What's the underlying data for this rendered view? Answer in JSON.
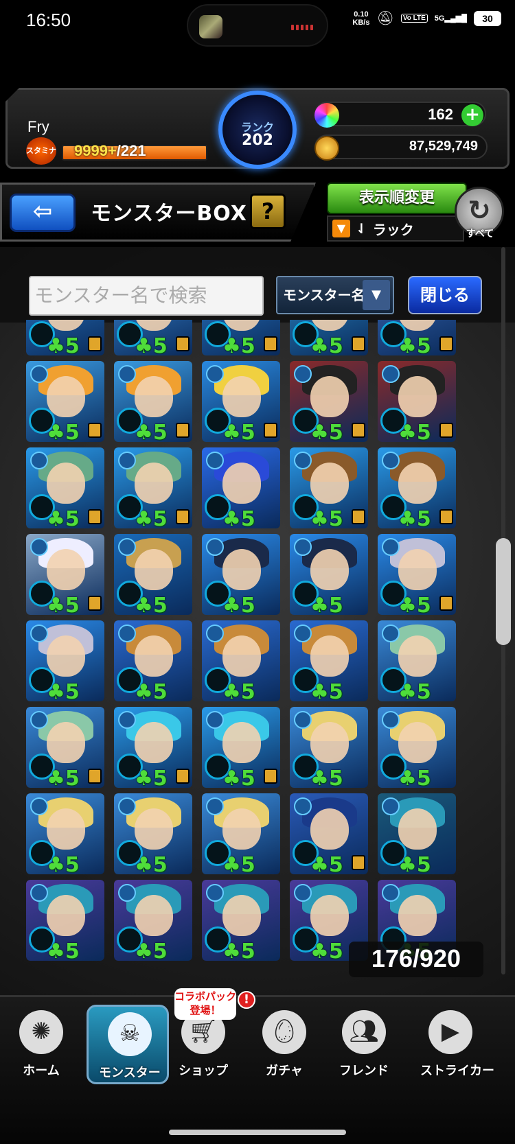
{
  "status_bar": {
    "time": "16:50",
    "net_speed_value": "0.10",
    "net_speed_unit": "KB/s",
    "volte": "Vo LTE",
    "network": "5G",
    "battery": "30"
  },
  "player": {
    "name": "Fry",
    "stamina_badge": "スタミナ",
    "stamina_current": "9999+",
    "stamina_max": "/221",
    "stamina_fill_fraction": 1.0,
    "rank_label": "ランク",
    "rank_value": "202"
  },
  "currency": {
    "orbs": "162",
    "add_orb_label": "+",
    "gold": "87,529,749"
  },
  "title_bar": {
    "back_icon": "arrow-left-icon",
    "back_glyph": "⇦",
    "title": "モンスターBOX",
    "help_label": "?"
  },
  "sort": {
    "button_label": "表示順変更",
    "criteria": "ラック",
    "filter_glyph": "▼",
    "sort_glyph": "⇃",
    "refresh_glyph": "↻",
    "refresh_label": "すべて"
  },
  "search": {
    "placeholder": "モンスター名で検索",
    "type_label": "モンスター名",
    "type_arrow": "▼",
    "close_label": "閉じる"
  },
  "box_counter": "176/920",
  "cards": [
    {
      "luck": "5",
      "locked": true,
      "bg": "#2a7ac8",
      "hair": "#9cd"
    },
    {
      "luck": "5",
      "locked": true,
      "bg": "#3a8ad8",
      "hair": "#dcb050"
    },
    {
      "luck": "5",
      "locked": true,
      "bg": "#2a7ac8",
      "hair": "#9cd"
    },
    {
      "luck": "5",
      "locked": true,
      "bg": "#2a8ac8",
      "hair": "#6ab"
    },
    {
      "luck": "5",
      "locked": true,
      "bg": "#3a6ab8",
      "hair": "#a8a"
    },
    {
      "luck": "5",
      "locked": true,
      "bg": "#3a9ae0",
      "hair": "#f0a030"
    },
    {
      "luck": "5",
      "locked": true,
      "bg": "#3a9ae0",
      "hair": "#f0a030"
    },
    {
      "luck": "5",
      "locked": true,
      "bg": "#2a8ae0",
      "hair": "#f0d040"
    },
    {
      "luck": "5",
      "locked": true,
      "bg": "#8a2a2a",
      "hair": "#222"
    },
    {
      "luck": "5",
      "locked": true,
      "bg": "#8a2a2a",
      "hair": "#222"
    },
    {
      "luck": "5",
      "locked": true,
      "bg": "#2a9ae8",
      "hair": "#6a8"
    },
    {
      "luck": "5",
      "locked": true,
      "bg": "#2a9ae8",
      "hair": "#6a8"
    },
    {
      "luck": "5",
      "locked": false,
      "bg": "#2a6ae8",
      "hair": "#2a4ad8"
    },
    {
      "luck": "5",
      "locked": true,
      "bg": "#2a9ae8",
      "hair": "#8a5a2a"
    },
    {
      "luck": "5",
      "locked": true,
      "bg": "#2a9ae8",
      "hair": "#8a5a2a"
    },
    {
      "luck": "5",
      "locked": true,
      "bg": "#8aa8c8",
      "hair": "#eef"
    },
    {
      "luck": "5",
      "locked": false,
      "bg": "#1a6ab8",
      "hair": "#c8a050"
    },
    {
      "luck": "5",
      "locked": false,
      "bg": "#2a8ae8",
      "hair": "#1a2a4a"
    },
    {
      "luck": "5",
      "locked": false,
      "bg": "#2a8ae8",
      "hair": "#1a2a4a"
    },
    {
      "luck": "5",
      "locked": true,
      "bg": "#2a8ae8",
      "hair": "#c0c0d8"
    },
    {
      "luck": "5",
      "locked": false,
      "bg": "#2a8ae8",
      "hair": "#c0c0d8"
    },
    {
      "luck": "5",
      "locked": false,
      "bg": "#2a6ad0",
      "hair": "#c88a3a"
    },
    {
      "luck": "5",
      "locked": false,
      "bg": "#2a6ad0",
      "hair": "#c88a3a"
    },
    {
      "luck": "5",
      "locked": false,
      "bg": "#2a6ad0",
      "hair": "#c88a3a"
    },
    {
      "luck": "5",
      "locked": false,
      "bg": "#3a8ad8",
      "hair": "#8ac8a8"
    },
    {
      "luck": "5",
      "locked": true,
      "bg": "#3a8ad8",
      "hair": "#8ac8a8"
    },
    {
      "luck": "5",
      "locked": true,
      "bg": "#2a9ae8",
      "hair": "#3ac8e8"
    },
    {
      "luck": "5",
      "locked": true,
      "bg": "#2a9ae8",
      "hair": "#3ac8e8"
    },
    {
      "luck": "5",
      "locked": false,
      "bg": "#3a8ad8",
      "hair": "#e8d070"
    },
    {
      "luck": "5",
      "locked": false,
      "bg": "#3a8ad8",
      "hair": "#e8d070"
    },
    {
      "luck": "5",
      "locked": false,
      "bg": "#3a8ad8",
      "hair": "#e8d070"
    },
    {
      "luck": "5",
      "locked": false,
      "bg": "#3a8ad8",
      "hair": "#e8d070"
    },
    {
      "luck": "5",
      "locked": false,
      "bg": "#3a8ad8",
      "hair": "#e8d070"
    },
    {
      "luck": "5",
      "locked": true,
      "bg": "#2a5ab8",
      "hair": "#1a3a8a"
    },
    {
      "luck": "5",
      "locked": false,
      "bg": "#1a5a7a",
      "hair": "#2a9ab8"
    },
    {
      "luck": "5",
      "locked": false,
      "bg": "#4a3a9a",
      "hair": "#2a9ab8"
    },
    {
      "luck": "5",
      "locked": false,
      "bg": "#4a3a9a",
      "hair": "#2a9ab8"
    },
    {
      "luck": "5",
      "locked": false,
      "bg": "#4a3a9a",
      "hair": "#2a9ab8"
    },
    {
      "luck": "5",
      "locked": false,
      "bg": "#4a3a9a",
      "hair": "#2a9ab8"
    },
    {
      "luck": "5",
      "locked": false,
      "bg": "#4a3a9a",
      "hair": "#2a9ab8"
    }
  ],
  "nav": [
    {
      "label": "ホーム",
      "icon": "home-icon"
    },
    {
      "label": "モンスター",
      "icon": "monster-icon"
    },
    {
      "label": "ショップ",
      "icon": "cart-icon"
    },
    {
      "label": "ガチャ",
      "icon": "egg-icon"
    },
    {
      "label": "フレンド",
      "icon": "friends-icon"
    },
    {
      "label": "ストライカー",
      "icon": "striker-icon"
    }
  ],
  "collab_bubble": "コラボパック\n登場！",
  "collab_alert": "!"
}
